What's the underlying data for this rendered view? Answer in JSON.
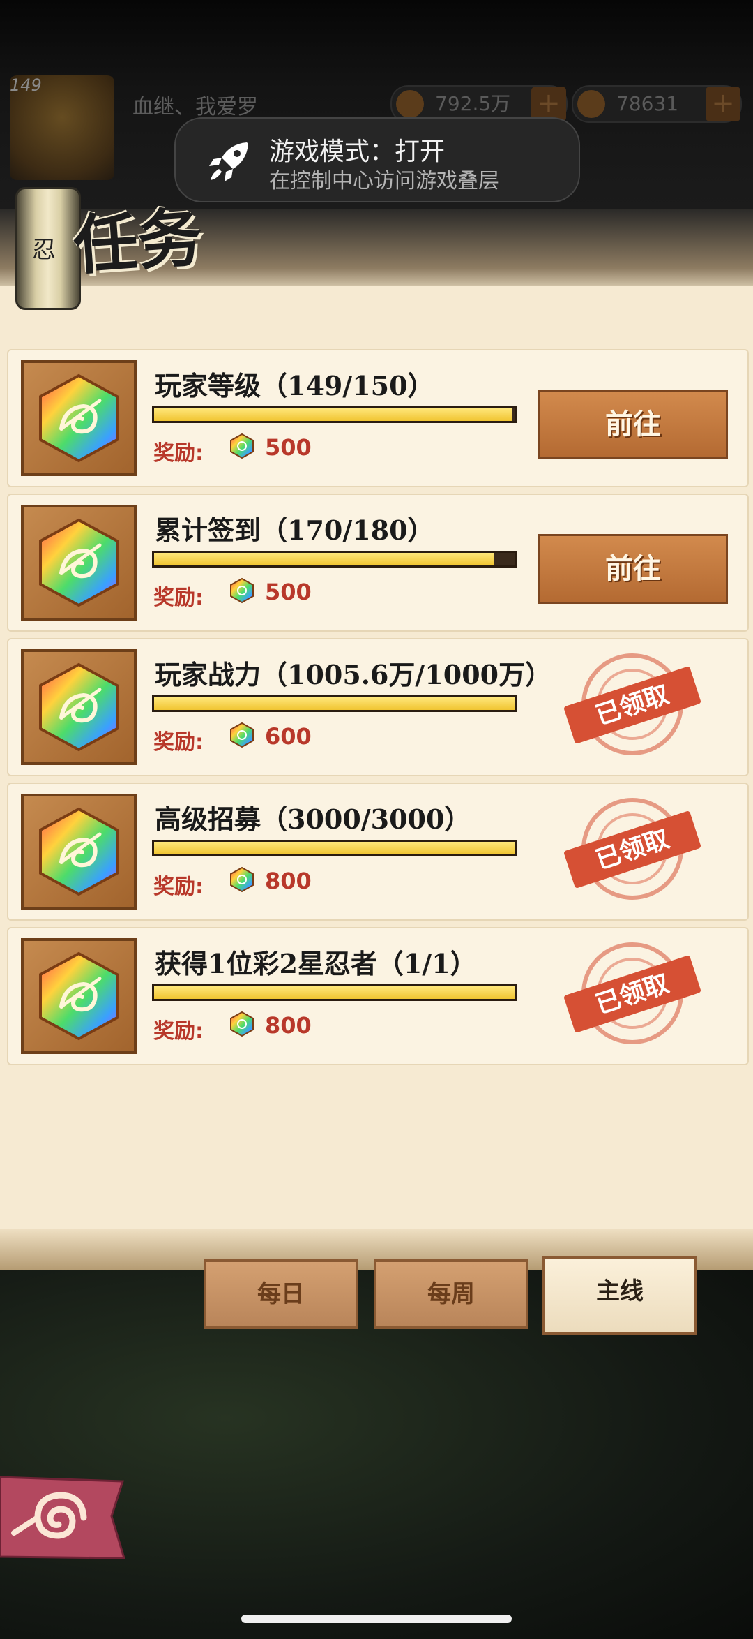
{
  "header": {
    "level": "149",
    "player_name": "血继、我爱罗",
    "coins": "792.5万",
    "gems": "78631"
  },
  "toast": {
    "title": "游戏模式：打开",
    "subtitle": "在控制中心访问游戏叠层"
  },
  "page": {
    "scroll_char": "忍",
    "title": "任务"
  },
  "quests": [
    {
      "title": "玩家等级（149/150）",
      "progress": 0.99,
      "reward_label": "奖励:",
      "reward": "500",
      "status": "go",
      "button": "前往"
    },
    {
      "title": "累计签到（170/180）",
      "progress": 0.94,
      "reward_label": "奖励:",
      "reward": "500",
      "status": "go",
      "button": "前往"
    },
    {
      "title": "玩家战力（1005.6万/1000万）",
      "progress": 1.0,
      "reward_label": "奖励:",
      "reward": "600",
      "status": "claimed",
      "button": "已领取"
    },
    {
      "title": "高级招募（3000/3000）",
      "progress": 1.0,
      "reward_label": "奖励:",
      "reward": "800",
      "status": "claimed",
      "button": "已领取"
    },
    {
      "title": "获得1位彩2星忍者（1/1）",
      "progress": 1.0,
      "reward_label": "奖励:",
      "reward": "800",
      "status": "claimed",
      "button": "已领取"
    }
  ],
  "tabs": [
    {
      "label": "每日",
      "active": false
    },
    {
      "label": "每周",
      "active": false
    },
    {
      "label": "主线",
      "active": true
    }
  ],
  "colors": {
    "panel_bg": "#f6ead2",
    "bar_fill": "#f0c431",
    "reward_text": "#b8382a",
    "go_button": "#c47a40",
    "stamp": "#d65034"
  },
  "icons": {
    "quest_icon": "rainbow-hexagon-leaf-icon",
    "reward_icon": "rainbow-gem-icon",
    "toast_icon": "rocket-icon",
    "back_icon": "swirl-flag-icon"
  }
}
